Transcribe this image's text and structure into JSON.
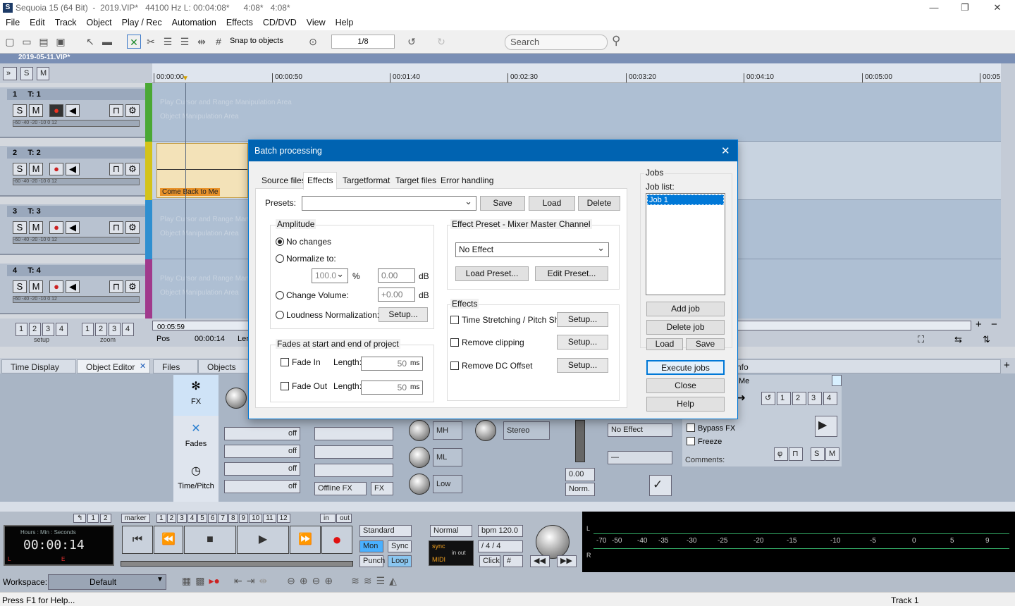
{
  "window": {
    "title": "Sequoia 15 (64 Bit)  -  2019.VIP*   44100 Hz L: 00:04:08*      4:08*   4:08*"
  },
  "menu": [
    "File",
    "Edit",
    "Track",
    "Object",
    "Play / Rec",
    "Automation",
    "Effects",
    "CD/DVD",
    "View",
    "Help"
  ],
  "toolbar": {
    "snap_label": "Snap to objects",
    "zoom_value": "1/8",
    "search_placeholder": "Search"
  },
  "project": {
    "tab": "2019-05-11.VIP*"
  },
  "ruler": {
    "ticks": [
      "00:00:00",
      "00:00:50",
      "00:01:40",
      "00:02:30",
      "00:03:20",
      "00:04:10",
      "00:05:00",
      "00:05"
    ]
  },
  "tracks": [
    {
      "num": "1",
      "name": "T: 1",
      "color": "#4aa834"
    },
    {
      "num": "2",
      "name": "T: 2",
      "color": "#d4c31a"
    },
    {
      "num": "3",
      "name": "T: 3",
      "color": "#2f8fd0"
    },
    {
      "num": "4",
      "name": "T: 4",
      "color": "#a03a8c"
    }
  ],
  "track_placeholder": {
    "line1": "Play Cursor and Range Manipulation Area",
    "line2": "Object Manipulation Area"
  },
  "clip": {
    "label": "Come Back to Me"
  },
  "meter_scale": "-60  -40  -20  -10   0   12",
  "side": {
    "setup": "setup",
    "zoom": "zoom",
    "nums": [
      "1",
      "2",
      "3",
      "4"
    ]
  },
  "position": {
    "time": "00:05:59",
    "pos_label": "Pos",
    "pos_value": "00:00:14",
    "len_label": "Len"
  },
  "panel_tabs": [
    "Time Display",
    "Object Editor",
    "Files",
    "Objects",
    "nfo"
  ],
  "fx_side": [
    {
      "icon": "fx-icon",
      "label": "FX"
    },
    {
      "icon": "fades-icon",
      "label": "Fades"
    },
    {
      "icon": "time-pitch-icon",
      "label": "Time/Pitch"
    }
  ],
  "fx_panel": {
    "off": "off",
    "offline_fx": "Offline FX",
    "fx": "FX",
    "eq": [
      "MH",
      "ML",
      "Low"
    ],
    "stereo": "Stereo",
    "vol": "0.00",
    "norm": "Norm.",
    "no_effect": "No Effect",
    "dash": "—",
    "bypass": "Bypass FX",
    "freeze": "Freeze",
    "comments": "Comments:",
    "me": "Me",
    "nums": [
      "1",
      "2",
      "3",
      "4"
    ],
    "s": "S",
    "m": "M"
  },
  "dialog": {
    "title": "Batch processing",
    "tabs": [
      "Source files",
      "Effects",
      "Targetformat",
      "Target files",
      "Error handling"
    ],
    "presets_label": "Presets:",
    "save": "Save",
    "load": "Load",
    "delete": "Delete",
    "amplitude": {
      "title": "Amplitude",
      "no_changes": "No changes",
      "normalize": "Normalize to:",
      "norm_value": "100.0",
      "pct": "%",
      "db_value": "0.00",
      "db": "dB",
      "change_volume": "Change Volume:",
      "vol_value": "+0.00",
      "loudness": "Loudness Normalization:",
      "setup": "Setup..."
    },
    "fades": {
      "title": "Fades at start and end of project",
      "fade_in": "Fade In",
      "fade_out": "Fade Out",
      "length": "Length:",
      "in_value": "50",
      "out_value": "50",
      "ms": "ms"
    },
    "effect_preset": {
      "title": "Effect Preset - Mixer Master Channel",
      "selected": "No Effect",
      "load_preset": "Load Preset...",
      "edit_preset": "Edit Preset..."
    },
    "effects": {
      "title": "Effects",
      "items": [
        "Time Stretching / Pitch Sh.",
        "Remove clipping",
        "Remove DC Offset"
      ],
      "setup": "Setup..."
    },
    "jobs": {
      "title": "Jobs",
      "list_label": "Job list:",
      "items": [
        "Job 1"
      ],
      "add": "Add job",
      "delete": "Delete job",
      "load": "Load",
      "save": "Save",
      "execute": "Execute jobs",
      "close": "Close",
      "help": "Help"
    }
  },
  "transport": {
    "markers": [
      "1",
      "2"
    ],
    "marker_label": "marker",
    "marker_nums": [
      "1",
      "2",
      "3",
      "4",
      "5",
      "6",
      "7",
      "8",
      "9",
      "10",
      "11",
      "12"
    ],
    "in": "in",
    "out": "out",
    "time_caption": "Hours : Min : Seconds",
    "time": "00:00:14",
    "l": "L",
    "e": "E",
    "standard": "Standard",
    "mon": "Mon",
    "sync": "Sync",
    "punch": "Punch",
    "loop": "Loop",
    "normal": "Normal",
    "bpm": "bpm  120.0",
    "sig": "/     4 / 4",
    "click": "Click",
    "sync2": "sync",
    "midi": "MIDI",
    "inout": "in  out"
  },
  "vu": {
    "l": "L",
    "r": "R",
    "scale": [
      "-70",
      "-50",
      "-40",
      "-35",
      "-30",
      "-25",
      "-20",
      "-15",
      "-10",
      "-5",
      "0",
      "5",
      "9"
    ]
  },
  "workspace": {
    "label": "Workspace:",
    "value": "Default"
  },
  "status": {
    "help": "Press F1 for Help...",
    "track": "Track 1"
  }
}
